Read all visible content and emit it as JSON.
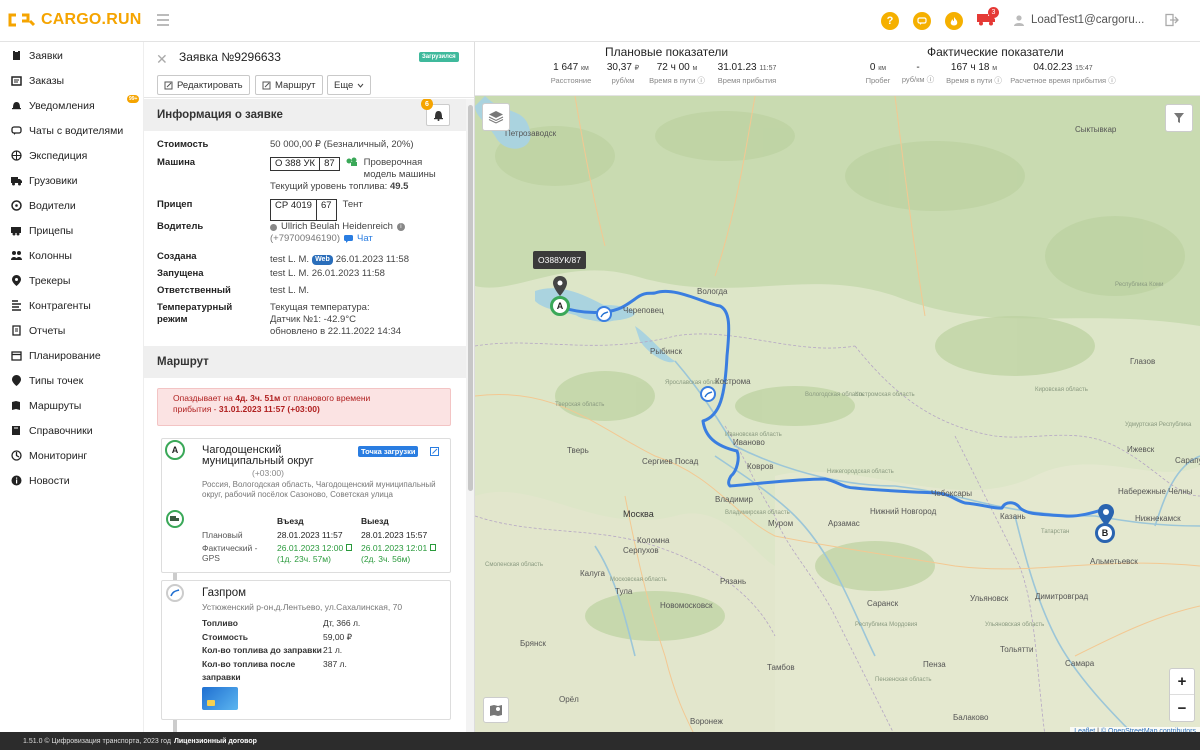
{
  "header": {
    "logo_text": "CARGO.RUN",
    "user_email": "LoadTest1@cargoru...",
    "truck_notifications": "3",
    "brand_color": "#f5a400"
  },
  "sidebar": {
    "items": [
      {
        "label": "Заявки",
        "icon": "clipboard-icon"
      },
      {
        "label": "Заказы",
        "icon": "orders-icon"
      },
      {
        "label": "Уведомления",
        "icon": "bell-icon",
        "badge": "99+"
      },
      {
        "label": "Чаты с водителями",
        "icon": "chat-icon"
      },
      {
        "label": "Экспедиция",
        "icon": "globe-icon"
      },
      {
        "label": "Грузовики",
        "icon": "truck-icon"
      },
      {
        "label": "Водители",
        "icon": "steering-wheel-icon"
      },
      {
        "label": "Прицепы",
        "icon": "trailer-icon"
      },
      {
        "label": "Колонны",
        "icon": "convoy-icon"
      },
      {
        "label": "Трекеры",
        "icon": "pin-icon"
      },
      {
        "label": "Контрагенты",
        "icon": "contractors-icon"
      },
      {
        "label": "Отчеты",
        "icon": "report-icon"
      },
      {
        "label": "Планирование",
        "icon": "calendar-icon"
      },
      {
        "label": "Типы точек",
        "icon": "point-icon"
      },
      {
        "label": "Маршруты",
        "icon": "route-icon"
      },
      {
        "label": "Справочники",
        "icon": "book-icon"
      },
      {
        "label": "Мониторинг",
        "icon": "monitor-icon"
      },
      {
        "label": "Новости",
        "icon": "info-icon"
      }
    ]
  },
  "order": {
    "title": "Заявка №9296633",
    "status": "Загрузился",
    "buttons": {
      "edit": "Редактировать",
      "route": "Маршрут",
      "more": "Еще"
    },
    "info_title": "Информация о заявке",
    "bell_badge": "6",
    "cost_label": "Стоимость",
    "cost_value": "50 000,00 ₽ (Безналичный, 20%)",
    "car_label": "Машина",
    "car_plate": "О 388 УК",
    "car_region": "87",
    "car_model": "Проверочная модель машины",
    "fuel_label": "Текущий уровень топлива:",
    "fuel_value": "49.5",
    "trailer_label": "Прицеп",
    "trailer_plate": "СР 4019",
    "trailer_region": "67",
    "trailer_type": "Тент",
    "driver_label": "Водитель",
    "driver_name": "Ullrich Beulah Heidenreich",
    "driver_phone": "(+79700946190)",
    "driver_chat": "Чат",
    "created_label": "Создана",
    "created_by": "test L. M.",
    "created_tag": "Web",
    "created_at": "26.01.2023 11:58",
    "started_label": "Запущена",
    "started_value": "test L. M. 26.01.2023 11:58",
    "responsible_label": "Ответственный",
    "responsible_value": "test L. M.",
    "temp_label": "Температурный режим",
    "temp_line1": "Текущая температура:",
    "temp_line2": "Датчик №1: -42.9°C",
    "temp_line3": "обновлено в 22.11.2022 14:34"
  },
  "route": {
    "title": "Маршрут",
    "late_prefix": "Опаздывает на",
    "late_amount": "4д. 3ч. 51м",
    "late_mid": "от планового времени",
    "late_suffix": "прибытия -",
    "late_time": "31.01.2023 11:57 (+03:00)",
    "stop_a": {
      "marker": "A",
      "name": "Чагодощенский муниципальный округ",
      "tz": "(+03:00)",
      "tag": "Точка загрузки",
      "address": "Россия, Вологодская область, Чагодощенский муниципальный округ, рабочий посёлок Сазоново, Советская улица",
      "col_in": "Въезд",
      "col_out": "Выезд",
      "plan_label": "Плановый",
      "plan_in": "28.01.2023 11:57",
      "plan_out": "28.01.2023 15:57",
      "fact_label": "Фактический - GPS",
      "fact_in": "26.01.2023 12:00",
      "fact_in_note": "(1д. 23ч. 57м)",
      "fact_out": "26.01.2023 12:01",
      "fact_out_note": "(2д. 3ч. 56м)"
    },
    "stop_gas": {
      "name": "Газпром",
      "address": "Устюженский р-он,д.Лентьево, ул.Сахалинская, 70",
      "fuel_label": "Топливо",
      "fuel_value": "Дт, 366 л.",
      "cost_label": "Стоимость",
      "cost_value": "59,00 ₽",
      "before_label": "Кол-во топлива до заправки",
      "before_value": "21 л.",
      "after_label": "Кол-во топлива после заправки",
      "after_value": "387 л."
    }
  },
  "stats": {
    "plan_title": "Плановые показатели",
    "fact_title": "Фактические показатели",
    "plan_distance": "1 647",
    "plan_distance_unit": "км",
    "plan_distance_label": "Расстояние",
    "plan_rate": "30,37",
    "plan_rate_unit": "₽",
    "plan_rate_label": "руб/км",
    "plan_travel": "72 ч 00",
    "plan_travel_unit": "м",
    "plan_travel_label": "Время в пути",
    "plan_arrival": "31.01.23",
    "plan_arrival_time": "11:57",
    "plan_arrival_label": "Время прибытия",
    "fact_mileage": "0",
    "fact_mileage_unit": "км",
    "fact_mileage_label": "Пробег",
    "fact_rate": "-",
    "fact_rate_label": "руб/км",
    "fact_travel": "167 ч 18",
    "fact_travel_unit": "м",
    "fact_travel_label": "Время в пути",
    "fact_arrival": "04.02.23",
    "fact_arrival_time": "15:47",
    "fact_arrival_label": "Расчетное время прибытия"
  },
  "map": {
    "vehicle_label": "О388УК/87",
    "marker_a": "A",
    "marker_b": "B",
    "zoom_in": "+",
    "zoom_out": "−",
    "attribution_leaflet": "Leaflet",
    "attribution_osm": "© OpenStreetMap contributors",
    "route_color": "#3a7ee0",
    "cities": [
      "Петрозаводск",
      "Сыктывкар",
      "Вологда",
      "Череповец",
      "Рыбинск",
      "Кострома",
      "Ярославская область",
      "Ивановская область",
      "Тверь",
      "Сергиев Посад",
      "Иваново",
      "Ковров",
      "Москва",
      "Владимир",
      "Нижегородская область",
      "Нижний Новгород",
      "Чебоксары",
      "Казань",
      "Набережные Челны",
      "Нижнекамск",
      "Ижевск",
      "Глазов",
      "Сарапул",
      "Татарстан",
      "Альметьевск",
      "Муром",
      "Арзамас",
      "Саранск",
      "Ульяновск",
      "Димитровград",
      "Тольятти",
      "Самара",
      "Коломна",
      "Серпухов",
      "Калуга",
      "Тула",
      "Рязань",
      "Брянск",
      "Орёл",
      "Тамбов",
      "Новомосковск",
      "Пенза",
      "Балаково",
      "Воронеж",
      "Тверская область",
      "Вологодская область",
      "Костромская область",
      "Кировская область",
      "Смоленская область",
      "Московская область",
      "Владимирская область",
      "Республика Мордовия",
      "Пензенская область",
      "Ульяновская область",
      "Удмуртская Республика",
      "Республика Коми"
    ]
  },
  "footer": {
    "text": "1.51.0 © Цифровизация транспорта, 2023 год",
    "license": "Лицензионный договор"
  }
}
